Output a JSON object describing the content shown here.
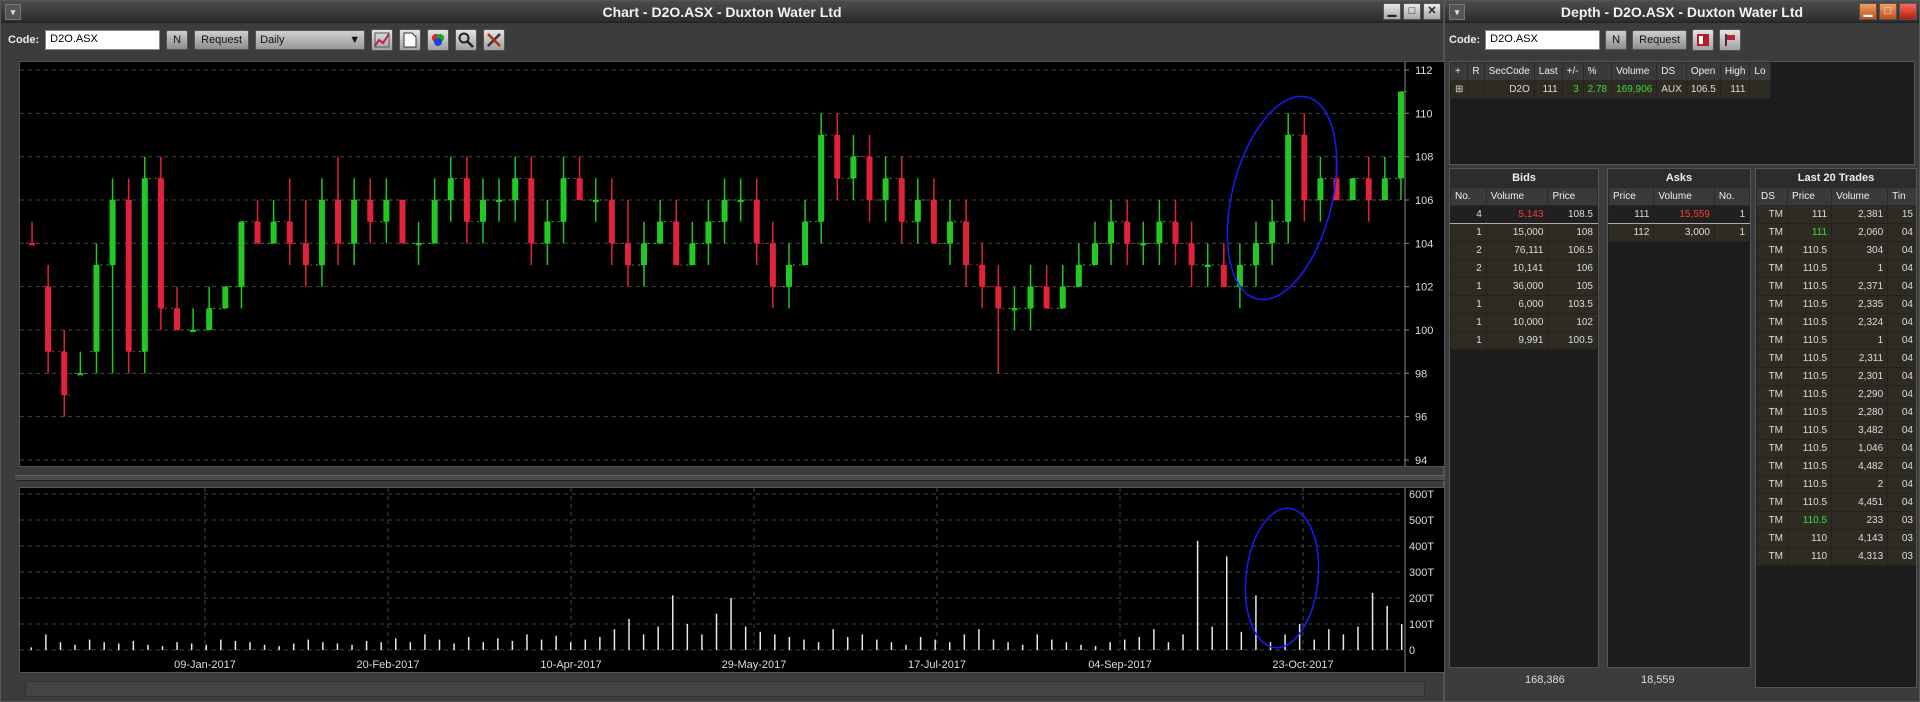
{
  "chart_window": {
    "title": "Chart - D2O.ASX - Duxton Water Ltd",
    "code_label": "Code:",
    "code_value": "D2O.ASX",
    "n_label": "N",
    "request_label": "Request",
    "period_value": "Daily",
    "menu_glyph": "▾",
    "btn_min": "▁",
    "btn_max": "□",
    "btn_close": "✕",
    "icons": [
      "chart-type-icon",
      "page-icon",
      "color-icon",
      "zoom-icon",
      "tools-icon"
    ],
    "colors": {
      "up": "#23c823",
      "down": "#e0233a",
      "background": "#000000",
      "annotation": "#1a1aff"
    }
  },
  "chart_data": [
    {
      "type": "bar",
      "subtype": "ohlc-daily-price",
      "ylim": [
        94,
        112
      ],
      "yticks": [
        94,
        96,
        98,
        100,
        102,
        104,
        106,
        108,
        110,
        112
      ],
      "xlabels": [
        "09-Jan-2017",
        "20-Feb-2017",
        "10-Apr-2017",
        "29-May-2017",
        "17-Jul-2017",
        "04-Sep-2017",
        "23-Oct-2017"
      ],
      "grid": true,
      "series": [
        {
          "values": [
            [
              104,
              105,
              104,
              104,
              -1
            ],
            [
              102,
              103,
              98,
              99,
              -1
            ],
            [
              99,
              100,
              96,
              97,
              -1
            ],
            [
              98,
              99,
              98,
              98,
              1
            ],
            [
              99,
              104,
              98,
              103,
              1
            ],
            [
              103,
              107,
              98,
              106,
              1
            ],
            [
              106,
              107,
              98,
              99,
              -1
            ],
            [
              99,
              108,
              98,
              107,
              1
            ],
            [
              107,
              108,
              100,
              101,
              -1
            ],
            [
              101,
              102,
              100,
              100,
              -1
            ],
            [
              100,
              101,
              100,
              100,
              0
            ],
            [
              100,
              102,
              100,
              101,
              1
            ],
            [
              101,
              102,
              101,
              102,
              1
            ],
            [
              102,
              105,
              101,
              105,
              1
            ],
            [
              105,
              106,
              104,
              104,
              -1
            ],
            [
              104,
              106,
              104,
              105,
              1
            ],
            [
              105,
              107,
              103,
              104,
              -1
            ],
            [
              104,
              106,
              102,
              103,
              -1
            ],
            [
              103,
              107,
              102,
              106,
              1
            ],
            [
              106,
              108,
              103,
              104,
              -1
            ],
            [
              104,
              107,
              103,
              106,
              1
            ],
            [
              106,
              107,
              104,
              105,
              -1
            ],
            [
              105,
              107,
              104,
              106,
              1
            ],
            [
              106,
              106,
              104,
              104,
              -1
            ],
            [
              104,
              105,
              103,
              104,
              0
            ],
            [
              104,
              107,
              104,
              106,
              1
            ],
            [
              106,
              108,
              105,
              107,
              1
            ],
            [
              107,
              108,
              104,
              105,
              -1
            ],
            [
              105,
              107,
              104,
              106,
              1
            ],
            [
              106,
              107,
              105,
              106,
              0
            ],
            [
              106,
              108,
              105,
              107,
              1
            ],
            [
              107,
              108,
              103,
              104,
              -1
            ],
            [
              104,
              106,
              103,
              105,
              1
            ],
            [
              105,
              108,
              104,
              107,
              1
            ],
            [
              107,
              108,
              106,
              106,
              -1
            ],
            [
              106,
              107,
              105,
              106,
              0
            ],
            [
              106,
              107,
              103,
              104,
              -1
            ],
            [
              104,
              106,
              102,
              103,
              -1
            ],
            [
              103,
              105,
              102,
              104,
              1
            ],
            [
              104,
              106,
              104,
              105,
              1
            ],
            [
              105,
              106,
              103,
              103,
              -1
            ],
            [
              103,
              105,
              103,
              104,
              1
            ],
            [
              104,
              106,
              103,
              105,
              1
            ],
            [
              105,
              107,
              104,
              106,
              1
            ],
            [
              106,
              107,
              105,
              106,
              0
            ],
            [
              106,
              107,
              103,
              104,
              -1
            ],
            [
              104,
              105,
              101,
              102,
              -1
            ],
            [
              102,
              104,
              101,
              103,
              1
            ],
            [
              103,
              106,
              103,
              105,
              1
            ],
            [
              105,
              110,
              104,
              109,
              1
            ],
            [
              109,
              110,
              106,
              107,
              -1
            ],
            [
              107,
              109,
              106,
              108,
              1
            ],
            [
              108,
              109,
              105,
              106,
              -1
            ],
            [
              106,
              108,
              105,
              107,
              1
            ],
            [
              107,
              108,
              104,
              105,
              -1
            ],
            [
              105,
              107,
              104,
              106,
              1
            ],
            [
              106,
              107,
              104,
              104,
              -1
            ],
            [
              104,
              106,
              103,
              105,
              1
            ],
            [
              105,
              106,
              102,
              103,
              -1
            ],
            [
              103,
              104,
              101,
              102,
              -1
            ],
            [
              102,
              103,
              98,
              101,
              -1
            ],
            [
              101,
              102,
              100,
              101,
              0
            ],
            [
              101,
              103,
              100,
              102,
              1
            ],
            [
              102,
              103,
              101,
              101,
              -1
            ],
            [
              101,
              103,
              101,
              102,
              1
            ],
            [
              102,
              104,
              102,
              103,
              1
            ],
            [
              103,
              105,
              103,
              104,
              1
            ],
            [
              104,
              106,
              103,
              105,
              1
            ],
            [
              105,
              106,
              103,
              104,
              -1
            ],
            [
              104,
              105,
              103,
              104,
              0
            ],
            [
              104,
              106,
              103,
              105,
              1
            ],
            [
              105,
              106,
              103,
              104,
              -1
            ],
            [
              104,
              105,
              102,
              103,
              -1
            ],
            [
              103,
              104,
              102,
              103,
              0
            ],
            [
              103,
              104,
              102,
              102,
              -1
            ],
            [
              102,
              104,
              101,
              103,
              1
            ],
            [
              103,
              105,
              102,
              104,
              1
            ],
            [
              104,
              106,
              103,
              105,
              1
            ],
            [
              105,
              110,
              104,
              109,
              1
            ],
            [
              109,
              110,
              105,
              106,
              -1
            ],
            [
              106,
              108,
              105,
              107,
              1
            ],
            [
              107,
              108,
              106,
              106,
              -1
            ],
            [
              106,
              107,
              106,
              107,
              1
            ],
            [
              107,
              108,
              105,
              106,
              -1
            ],
            [
              106,
              108,
              106,
              107,
              1
            ],
            [
              107,
              111,
              106,
              111,
              1
            ]
          ],
          "value_format": "[open, high, low, close, direction]"
        }
      ]
    },
    {
      "type": "bar",
      "subtype": "volume",
      "ylim": [
        0,
        600
      ],
      "yticks": [
        "0",
        "100T",
        "200T",
        "300T",
        "400T",
        "500T",
        "600T"
      ],
      "grid": true,
      "values": [
        10,
        60,
        30,
        20,
        40,
        30,
        25,
        35,
        20,
        15,
        30,
        25,
        20,
        40,
        35,
        30,
        20,
        15,
        25,
        40,
        30,
        25,
        20,
        35,
        30,
        45,
        30,
        60,
        40,
        25,
        50,
        30,
        45,
        35,
        60,
        40,
        55,
        30,
        40,
        50,
        80,
        120,
        60,
        90,
        210,
        100,
        60,
        140,
        200,
        90,
        70,
        60,
        50,
        40,
        30,
        80,
        50,
        60,
        40,
        30,
        20,
        50,
        40,
        30,
        60,
        80,
        40,
        30,
        20,
        60,
        40,
        30,
        20,
        15,
        30,
        40,
        50,
        80,
        30,
        60,
        420,
        90,
        360,
        70,
        210,
        30,
        60,
        100,
        40,
        80,
        60,
        90,
        220,
        170,
        100
      ],
      "unit": "T"
    }
  ],
  "depth_window": {
    "title": "Depth - D2O.ASX - Duxton Water Ltd",
    "code_label": "Code:",
    "code_value": "D2O.ASX",
    "n_label": "N",
    "request_label": "Request",
    "menu_glyph": "▾",
    "quote_headers": [
      "+",
      "R",
      "SecCode",
      "Last",
      "+/-",
      "%",
      "Volume",
      "DS",
      "Open",
      "High",
      "Lo"
    ],
    "quote_row": {
      "expand": "⊞",
      "r": "",
      "seccode": "D2O",
      "last": "111",
      "change": "3",
      "pct": "2.78",
      "volume": "169,906",
      "ds": "AUX",
      "open": "106.5",
      "high": "111",
      "low": ""
    },
    "bids_title": "Bids",
    "asks_title": "Asks",
    "trades_title": "Last 20 Trades",
    "bids_headers": [
      "No.",
      "Volume",
      "Price"
    ],
    "asks_headers": [
      "Price",
      "Volume",
      "No."
    ],
    "trades_headers": [
      "DS",
      "Price",
      "Volume",
      "Tin"
    ],
    "bids": [
      [
        "4",
        "5,143",
        "108.5"
      ],
      [
        "1",
        "15,000",
        "108"
      ],
      [
        "2",
        "76,111",
        "106.5"
      ],
      [
        "2",
        "10,141",
        "106"
      ],
      [
        "1",
        "36,000",
        "105"
      ],
      [
        "1",
        "6,000",
        "103.5"
      ],
      [
        "1",
        "10,000",
        "102"
      ],
      [
        "1",
        "9,991",
        "100.5"
      ]
    ],
    "asks": [
      [
        "111",
        "15,559",
        "1"
      ],
      [
        "112",
        "3,000",
        "1"
      ]
    ],
    "trades": [
      [
        "TM",
        "111",
        "2,381",
        "15"
      ],
      [
        "TM",
        "111",
        "2,060",
        "04"
      ],
      [
        "TM",
        "110.5",
        "304",
        "04"
      ],
      [
        "TM",
        "110.5",
        "1",
        "04"
      ],
      [
        "TM",
        "110.5",
        "2,371",
        "04"
      ],
      [
        "TM",
        "110.5",
        "2,335",
        "04"
      ],
      [
        "TM",
        "110.5",
        "2,324",
        "04"
      ],
      [
        "TM",
        "110.5",
        "1",
        "04"
      ],
      [
        "TM",
        "110.5",
        "2,311",
        "04"
      ],
      [
        "TM",
        "110.5",
        "2,301",
        "04"
      ],
      [
        "TM",
        "110.5",
        "2,290",
        "04"
      ],
      [
        "TM",
        "110.5",
        "2,280",
        "04"
      ],
      [
        "TM",
        "110.5",
        "3,482",
        "04"
      ],
      [
        "TM",
        "110.5",
        "1,046",
        "04"
      ],
      [
        "TM",
        "110.5",
        "4,482",
        "04"
      ],
      [
        "TM",
        "110.5",
        "2",
        "04"
      ],
      [
        "TM",
        "110.5",
        "4,451",
        "04"
      ],
      [
        "TM",
        "110.5",
        "233",
        "03"
      ],
      [
        "TM",
        "110",
        "4,143",
        "03"
      ],
      [
        "TM",
        "110",
        "4,313",
        "03"
      ]
    ],
    "bids_total": "168,386",
    "asks_total": "18,559"
  }
}
